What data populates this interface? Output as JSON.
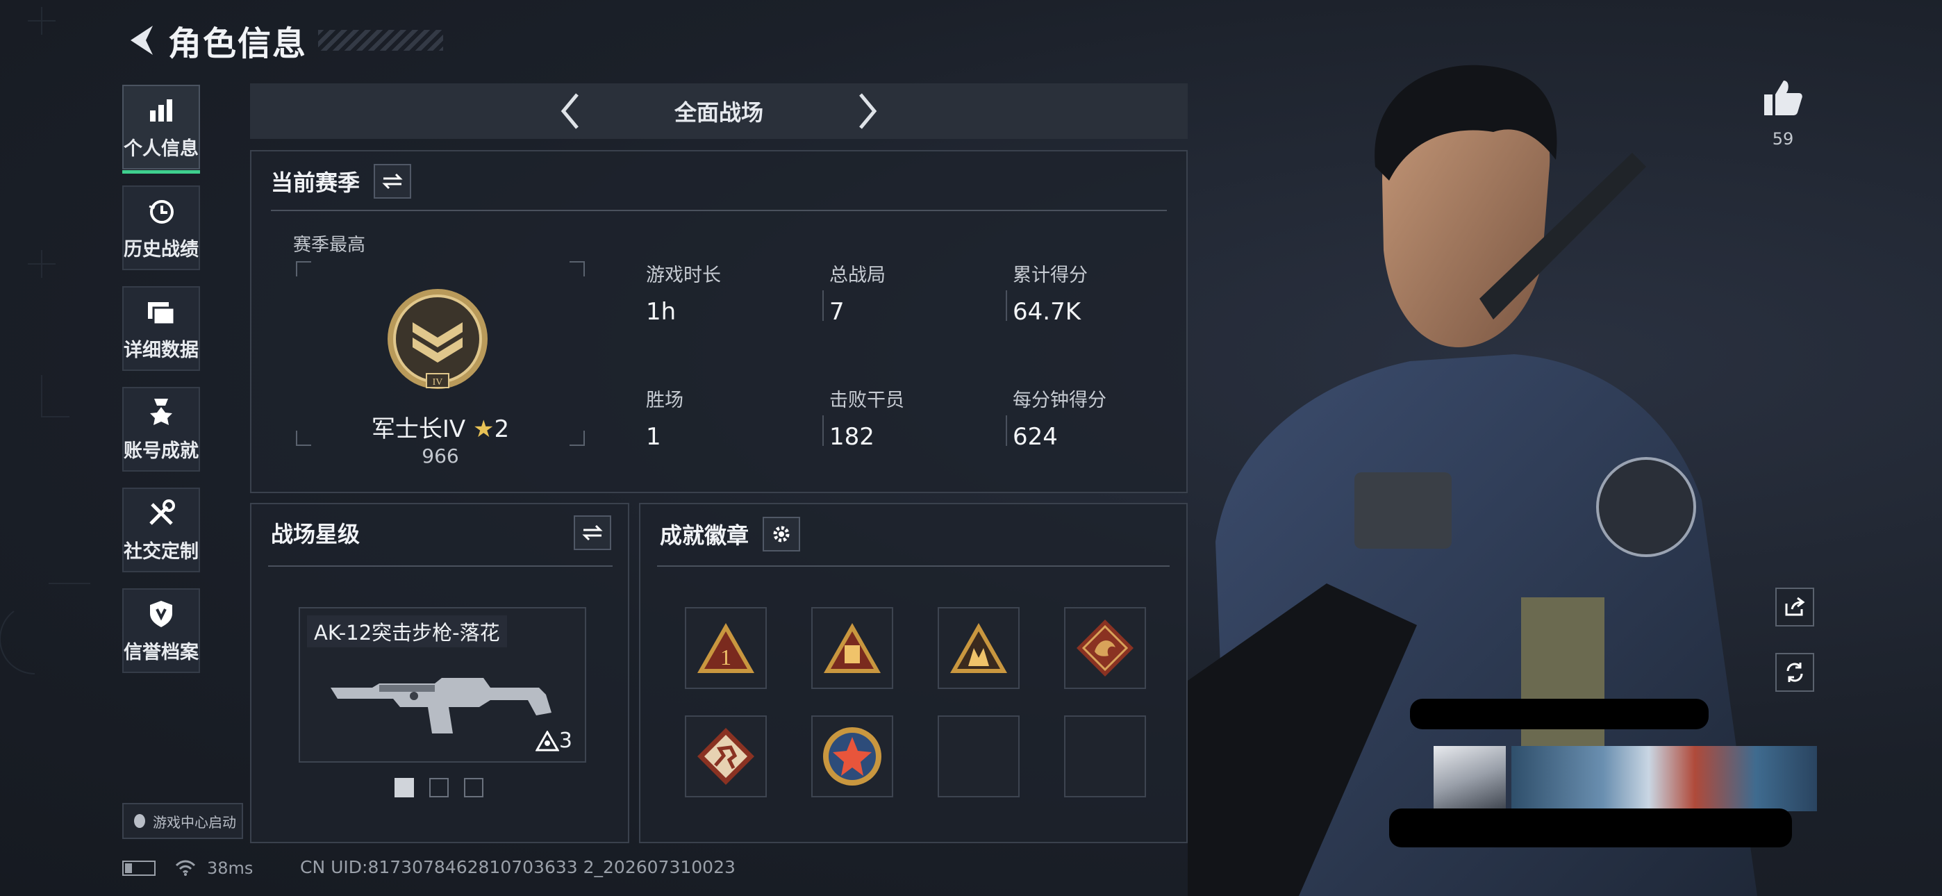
{
  "header": {
    "title": "角色信息"
  },
  "sidebar": {
    "items": [
      {
        "label": "个人信息",
        "icon": "bar-chart-icon",
        "active": true
      },
      {
        "label": "历史战绩",
        "icon": "history-clock-icon"
      },
      {
        "label": "详细数据",
        "icon": "folder-icon"
      },
      {
        "label": "账号成就",
        "icon": "medal-icon"
      },
      {
        "label": "社交定制",
        "icon": "tools-icon"
      },
      {
        "label": "信誉档案",
        "icon": "shield-icon"
      }
    ],
    "launch": "游戏中心启动"
  },
  "mode": {
    "title": "全面战场"
  },
  "season": {
    "title": "当前赛季",
    "best_label": "赛季最高",
    "rank_name": "军士长IV",
    "rank_stars": "2",
    "rank_points": "966",
    "stats": [
      {
        "label": "游戏时长",
        "value": "1h"
      },
      {
        "label": "总战局",
        "value": "7"
      },
      {
        "label": "累计得分",
        "value": "64.7K"
      },
      {
        "label": "胜场",
        "value": "1"
      },
      {
        "label": "击败干员",
        "value": "182"
      },
      {
        "label": "每分钟得分",
        "value": "624"
      }
    ]
  },
  "star_level": {
    "title": "战场星级",
    "weapon_name": "AK-12突击步枪-落花",
    "weapon_level": "3",
    "pages": 3,
    "current_page": 1
  },
  "badges": {
    "title": "成就徽章",
    "items": [
      "rank-1-badge",
      "supply-badge",
      "squad-badge",
      "dragon-badge",
      "runner-badge",
      "star-emblem-badge",
      "empty-slot",
      "empty-slot"
    ]
  },
  "status": {
    "ping": "38ms",
    "uid": "CN UID:8173078462810703633 2_202607310023"
  },
  "social": {
    "likes": "59"
  },
  "colors": {
    "accent": "#3fcf8e",
    "bg": "#1b2029",
    "panel_border": "#3a414d"
  }
}
